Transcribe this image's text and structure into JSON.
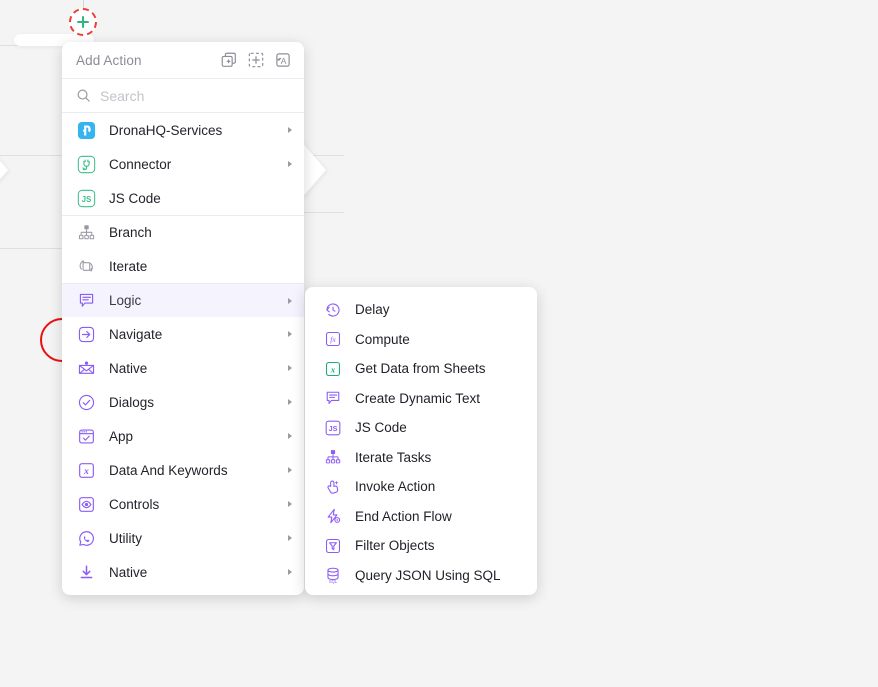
{
  "colors": {
    "canvas_bg": "#f4f4f5",
    "panel_bg": "#ffffff",
    "accent_purple": "#8b5cf6",
    "accent_blue": "#35b4ef",
    "accent_green": "#2fb67c",
    "annotation_red": "#ee2020",
    "active_row_bg": "#f4f3fe",
    "placeholder_text": "#c3c3cb"
  },
  "panel": {
    "title": "Add Action",
    "header_icons": [
      {
        "name": "duplicate-icon",
        "label": "Duplicate"
      },
      {
        "name": "add-selection-icon",
        "label": "Add Selection"
      },
      {
        "name": "translate-text-icon",
        "label": "Translate Text"
      }
    ],
    "search": {
      "placeholder": "Search",
      "value": "",
      "icon": "search-icon"
    },
    "items": [
      {
        "label": "DronaHQ-Services",
        "icon": "dronahq-logo-icon",
        "has_submenu": true,
        "separator_above": false,
        "active": false
      },
      {
        "label": "Connector",
        "icon": "plug-connector-icon",
        "has_submenu": true,
        "separator_above": false,
        "active": false
      },
      {
        "label": "JS Code",
        "icon": "js-code-icon",
        "has_submenu": false,
        "separator_above": false,
        "active": false
      },
      {
        "label": "Branch",
        "icon": "branch-tree-icon",
        "has_submenu": false,
        "separator_above": true,
        "active": false
      },
      {
        "label": "Iterate",
        "icon": "iterate-loop-icon",
        "has_submenu": false,
        "separator_above": false,
        "active": false
      },
      {
        "label": "Logic",
        "icon": "logic-speech-icon",
        "has_submenu": true,
        "separator_above": true,
        "active": true
      },
      {
        "label": "Navigate",
        "icon": "navigate-arrow-icon",
        "has_submenu": true,
        "separator_above": false,
        "active": false
      },
      {
        "label": "Native",
        "icon": "mail-native-icon",
        "has_submenu": true,
        "separator_above": false,
        "active": false
      },
      {
        "label": "Dialogs",
        "icon": "check-circle-icon",
        "has_submenu": true,
        "separator_above": false,
        "active": false
      },
      {
        "label": "App",
        "icon": "app-window-icon",
        "has_submenu": true,
        "separator_above": false,
        "active": false
      },
      {
        "label": "Data And Keywords",
        "icon": "variable-x-icon",
        "has_submenu": true,
        "separator_above": false,
        "active": false
      },
      {
        "label": "Controls",
        "icon": "eye-controls-icon",
        "has_submenu": true,
        "separator_above": false,
        "active": false
      },
      {
        "label": "Utility",
        "icon": "whatsapp-utility-icon",
        "has_submenu": true,
        "separator_above": false,
        "active": false
      },
      {
        "label": "Native",
        "icon": "download-arrow-icon",
        "has_submenu": true,
        "separator_above": false,
        "active": false
      }
    ]
  },
  "submenu": {
    "parent": "Logic",
    "items": [
      {
        "label": "Delay",
        "icon": "clock-delay-icon"
      },
      {
        "label": "Compute",
        "icon": "fx-compute-icon"
      },
      {
        "label": "Get Data from Sheets",
        "icon": "excel-sheets-icon"
      },
      {
        "label": "Create Dynamic Text",
        "icon": "dynamic-text-icon"
      },
      {
        "label": "JS Code",
        "icon": "js-code-icon"
      },
      {
        "label": "Iterate Tasks",
        "icon": "branch-tree-icon"
      },
      {
        "label": "Invoke Action",
        "icon": "invoke-click-icon"
      },
      {
        "label": "End Action Flow",
        "icon": "end-flow-bolt-icon"
      },
      {
        "label": "Filter Objects",
        "icon": "filter-funnel-icon"
      },
      {
        "label": "Query JSON Using SQL",
        "icon": "database-sql-icon"
      }
    ]
  },
  "annotations": {
    "red_underline_target": "Compute",
    "red_circle_target": "flow-node",
    "plus_button": {
      "name": "add-node-plus-button",
      "icon": "plus-icon"
    }
  }
}
